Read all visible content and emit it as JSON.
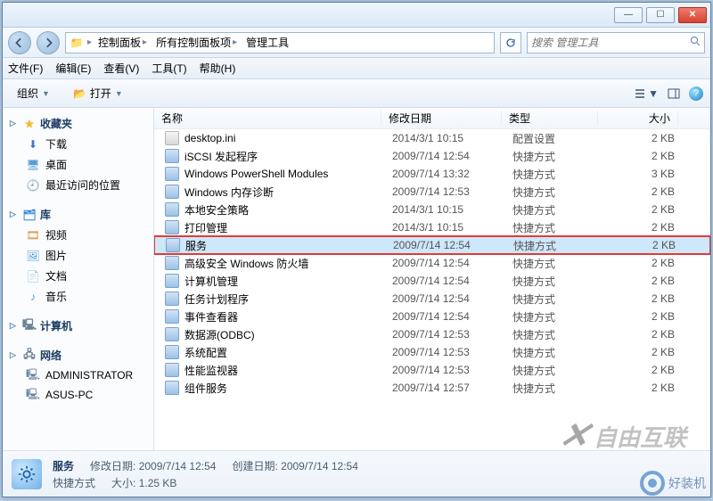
{
  "window": {
    "min": "—",
    "max": "☐",
    "close": "✕"
  },
  "breadcrumb": {
    "items": [
      "控制面板",
      "所有控制面板项",
      "管理工具"
    ]
  },
  "search": {
    "placeholder": "搜索 管理工具"
  },
  "menu": {
    "file": "文件(F)",
    "edit": "编辑(E)",
    "view": "查看(V)",
    "tools": "工具(T)",
    "help": "帮助(H)"
  },
  "toolbar": {
    "organize": "组织",
    "open": "打开"
  },
  "sidebar": {
    "fav": {
      "head": "收藏夹",
      "items": [
        "下载",
        "桌面",
        "最近访问的位置"
      ]
    },
    "lib": {
      "head": "库",
      "items": [
        "视频",
        "图片",
        "文档",
        "音乐"
      ]
    },
    "comp": {
      "head": "计算机"
    },
    "net": {
      "head": "网络",
      "items": [
        "ADMINISTRATOR",
        "ASUS-PC"
      ]
    }
  },
  "columns": {
    "name": "名称",
    "date": "修改日期",
    "type": "类型",
    "size": "大小"
  },
  "files": [
    {
      "name": "desktop.ini",
      "date": "2014/3/1 10:15",
      "type": "配置设置",
      "size": "2 KB",
      "icon": "ini"
    },
    {
      "name": "iSCSI 发起程序",
      "date": "2009/7/14 12:54",
      "type": "快捷方式",
      "size": "2 KB",
      "icon": "lnk"
    },
    {
      "name": "Windows PowerShell Modules",
      "date": "2009/7/14 13:32",
      "type": "快捷方式",
      "size": "3 KB",
      "icon": "lnk"
    },
    {
      "name": "Windows 内存诊断",
      "date": "2009/7/14 12:53",
      "type": "快捷方式",
      "size": "2 KB",
      "icon": "lnk"
    },
    {
      "name": "本地安全策略",
      "date": "2014/3/1 10:15",
      "type": "快捷方式",
      "size": "2 KB",
      "icon": "lnk"
    },
    {
      "name": "打印管理",
      "date": "2014/3/1 10:15",
      "type": "快捷方式",
      "size": "2 KB",
      "icon": "lnk"
    },
    {
      "name": "服务",
      "date": "2009/7/14 12:54",
      "type": "快捷方式",
      "size": "2 KB",
      "icon": "lnk",
      "selected": true,
      "highlight": true
    },
    {
      "name": "高级安全 Windows 防火墙",
      "date": "2009/7/14 12:54",
      "type": "快捷方式",
      "size": "2 KB",
      "icon": "lnk"
    },
    {
      "name": "计算机管理",
      "date": "2009/7/14 12:54",
      "type": "快捷方式",
      "size": "2 KB",
      "icon": "lnk"
    },
    {
      "name": "任务计划程序",
      "date": "2009/7/14 12:54",
      "type": "快捷方式",
      "size": "2 KB",
      "icon": "lnk"
    },
    {
      "name": "事件查看器",
      "date": "2009/7/14 12:54",
      "type": "快捷方式",
      "size": "2 KB",
      "icon": "lnk"
    },
    {
      "name": "数据源(ODBC)",
      "date": "2009/7/14 12:53",
      "type": "快捷方式",
      "size": "2 KB",
      "icon": "lnk"
    },
    {
      "name": "系统配置",
      "date": "2009/7/14 12:53",
      "type": "快捷方式",
      "size": "2 KB",
      "icon": "lnk"
    },
    {
      "name": "性能监视器",
      "date": "2009/7/14 12:53",
      "type": "快捷方式",
      "size": "2 KB",
      "icon": "lnk"
    },
    {
      "name": "组件服务",
      "date": "2009/7/14 12:57",
      "type": "快捷方式",
      "size": "2 KB",
      "icon": "lnk"
    }
  ],
  "details": {
    "title": "服务",
    "type_label": "快捷方式",
    "mod_label": "修改日期:",
    "mod": "2009/7/14 12:54",
    "create_label": "创建日期:",
    "create": "2009/7/14 12:54",
    "size_label": "大小:",
    "size": "1.25 KB"
  },
  "watermark": "自由互联",
  "stamp": "好装机"
}
